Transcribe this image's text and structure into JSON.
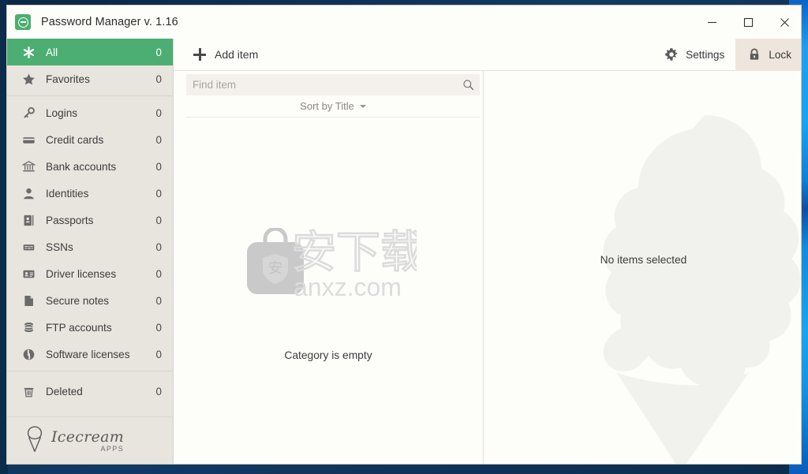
{
  "window": {
    "title": "Password Manager v. 1.16",
    "app_icon": "password-manager-icon",
    "controls": {
      "minimize": "minimize-icon",
      "maximize": "maximize-icon",
      "close": "close-icon"
    }
  },
  "sidebar": {
    "items": [
      {
        "label": "All",
        "count": "0",
        "icon": "asterisk-icon",
        "selected": true
      },
      {
        "label": "Favorites",
        "count": "0",
        "icon": "star-icon",
        "selected": false
      },
      {
        "label": "Logins",
        "count": "0",
        "icon": "key-icon",
        "selected": false
      },
      {
        "label": "Credit cards",
        "count": "0",
        "icon": "credit-card-icon",
        "selected": false
      },
      {
        "label": "Bank accounts",
        "count": "0",
        "icon": "bank-icon",
        "selected": false
      },
      {
        "label": "Identities",
        "count": "0",
        "icon": "person-icon",
        "selected": false
      },
      {
        "label": "Passports",
        "count": "0",
        "icon": "passport-icon",
        "selected": false
      },
      {
        "label": "SSNs",
        "count": "0",
        "icon": "ssn-card-icon",
        "selected": false
      },
      {
        "label": "Driver licenses",
        "count": "0",
        "icon": "id-card-icon",
        "selected": false
      },
      {
        "label": "Secure notes",
        "count": "0",
        "icon": "note-icon",
        "selected": false
      },
      {
        "label": "FTP accounts",
        "count": "0",
        "icon": "database-icon",
        "selected": false
      },
      {
        "label": "Software licenses",
        "count": "0",
        "icon": "disc-icon",
        "selected": false
      },
      {
        "label": "Deleted",
        "count": "0",
        "icon": "trash-icon",
        "selected": false
      }
    ],
    "brand": {
      "name": "Icecream",
      "sub": "APPS",
      "icon": "ice-cream-cone-icon"
    }
  },
  "toolbar": {
    "add_item_label": "Add item",
    "add_item_icon": "plus-icon",
    "settings_label": "Settings",
    "settings_icon": "gear-icon",
    "lock_label": "Lock",
    "lock_icon": "lock-icon"
  },
  "list_pane": {
    "search_placeholder": "Find item",
    "search_value": "",
    "search_icon": "search-icon",
    "sort_label": "Sort by Title",
    "sort_caret": "chevron-down-icon",
    "empty_message": "Category is empty",
    "watermark": {
      "text_cn": "安下载",
      "text_url": "anxz.com",
      "badge_char": "安"
    }
  },
  "detail_pane": {
    "empty_message": "No items selected",
    "watermark_icon": "ice-cream-cone-watermark"
  },
  "colors": {
    "accent_green": "#4cae72",
    "sidebar_bg": "#e8e4de",
    "window_bg": "#fdfdfa",
    "lock_highlight": "#eee5dc",
    "desktop_navy": "#0d2b4a"
  }
}
